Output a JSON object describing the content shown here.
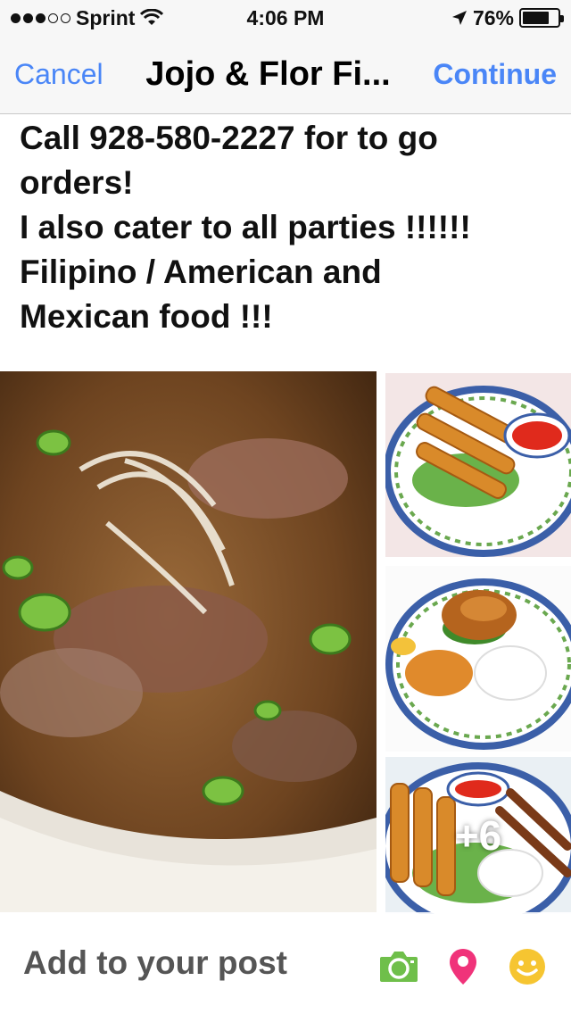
{
  "status_bar": {
    "carrier": "Sprint",
    "time": "4:06 PM",
    "battery": "76%",
    "battery_level": 0.76,
    "icons": [
      "signal-dots-icon",
      "wifi-icon",
      "location-arrow-icon",
      "battery-icon"
    ]
  },
  "nav": {
    "cancel": "Cancel",
    "title": "Jojo & Flor Fi...",
    "continue": "Continue"
  },
  "post": {
    "lines": [
      "Call 928-580-2227 for to go",
      "orders!",
      "I also cater to all parties !!!!!!",
      "Filipino / American and",
      "Mexican food !!!"
    ]
  },
  "photos": {
    "more_count": "+6"
  },
  "composer": {
    "label": "Add to your post",
    "icons": [
      "camera-icon",
      "location-pin-icon",
      "emoji-icon"
    ],
    "colors": {
      "camera": "#6fbf4a",
      "pin": "#f0337a",
      "emoji": "#f6c531"
    }
  },
  "colors": {
    "accent": "#4a86f7"
  }
}
